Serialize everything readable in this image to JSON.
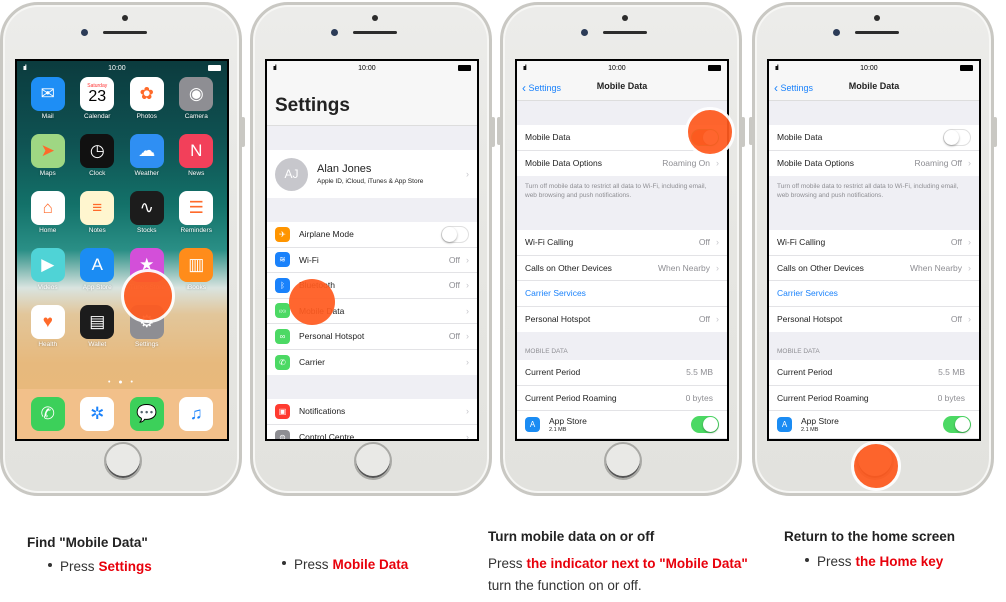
{
  "status_bar": {
    "time": "10:00",
    "signal": "ııl"
  },
  "phone1": {
    "apps": [
      {
        "label": "Mail",
        "icon": "mail-icon",
        "glyph": "✉",
        "color": "#1e8ef5"
      },
      {
        "label": "Calendar",
        "icon": "calendar-icon",
        "day": "Saturday",
        "date": "23",
        "color": "#ffffff"
      },
      {
        "label": "Photos",
        "icon": "photos-icon",
        "glyph": "✿",
        "color": "#ffffff"
      },
      {
        "label": "Camera",
        "icon": "camera-icon",
        "glyph": "◉",
        "color": "#8e8e93"
      },
      {
        "label": "Maps",
        "icon": "maps-icon",
        "glyph": "➤",
        "color": "#9fd783"
      },
      {
        "label": "Clock",
        "icon": "clock-icon",
        "glyph": "◷",
        "color": "#111111"
      },
      {
        "label": "Weather",
        "icon": "weather-icon",
        "glyph": "☁",
        "color": "#2f8ff3"
      },
      {
        "label": "News",
        "icon": "news-icon",
        "glyph": "N",
        "color": "#f2405a"
      },
      {
        "label": "Home",
        "icon": "home-app-icon",
        "glyph": "⌂",
        "color": "#ffffff"
      },
      {
        "label": "Notes",
        "icon": "notes-icon",
        "glyph": "≡",
        "color": "#fff6cf"
      },
      {
        "label": "Stocks",
        "icon": "stocks-icon",
        "glyph": "∿",
        "color": "#1c1c1c"
      },
      {
        "label": "Reminders",
        "icon": "reminders-icon",
        "glyph": "☰",
        "color": "#ffffff"
      },
      {
        "label": "Videos",
        "icon": "videos-icon",
        "glyph": "▶",
        "color": "#4fd3d6"
      },
      {
        "label": "App Store",
        "icon": "app-store-icon",
        "glyph": "A",
        "color": "#1b8cf3"
      },
      {
        "label": "iTunes Store",
        "icon": "itunes-store-icon",
        "glyph": "★",
        "color": "#d34fd9"
      },
      {
        "label": "iBooks",
        "icon": "ibooks-icon",
        "glyph": "▥",
        "color": "#ff8c1a"
      },
      {
        "label": "Health",
        "icon": "health-icon",
        "glyph": "♥",
        "color": "#ffffff"
      },
      {
        "label": "Wallet",
        "icon": "wallet-icon",
        "glyph": "▤",
        "color": "#1c1c1c"
      },
      {
        "label": "Settings",
        "icon": "settings-icon",
        "glyph": "⚙",
        "color": "#8e8e93"
      }
    ],
    "pager": "• ● •",
    "dock": [
      {
        "icon": "phone-icon",
        "glyph": "✆",
        "color": "#3cd05a"
      },
      {
        "icon": "safari-icon",
        "glyph": "✲",
        "color": "#ffffff"
      },
      {
        "icon": "messages-icon",
        "glyph": "💬",
        "color": "#3cd05a"
      },
      {
        "icon": "music-icon",
        "glyph": "♫",
        "color": "#ffffff"
      }
    ]
  },
  "phone2": {
    "title": "Settings",
    "profile": {
      "initials": "AJ",
      "name": "Alan Jones",
      "subtitle": "Apple ID, iCloud, iTunes & App Store"
    },
    "rows1": [
      {
        "label": "Airplane Mode",
        "value": "",
        "icon": "airplane-icon",
        "glyph": "✈",
        "color": "#ff9500",
        "toggle": "off"
      },
      {
        "label": "Wi-Fi",
        "value": "Off",
        "icon": "wifi-icon",
        "glyph": "≋",
        "color": "#1a82fb"
      },
      {
        "label": "Bluetooth",
        "value": "Off",
        "icon": "bluetooth-icon",
        "glyph": "ᛒ",
        "color": "#1a82fb"
      },
      {
        "label": "Mobile Data",
        "value": "",
        "icon": "mobile-data-icon",
        "glyph": "((•))",
        "color": "#4cd964"
      },
      {
        "label": "Personal Hotspot",
        "value": "Off",
        "icon": "hotspot-icon",
        "glyph": "∞",
        "color": "#4cd964"
      },
      {
        "label": "Carrier",
        "value": "",
        "icon": "carrier-icon",
        "glyph": "✆",
        "color": "#4cd964"
      }
    ],
    "rows2": [
      {
        "label": "Notifications",
        "icon": "notifications-icon",
        "glyph": "▣",
        "color": "#ff3b30"
      },
      {
        "label": "Control Centre",
        "icon": "control-centre-icon",
        "glyph": "⊜",
        "color": "#8e8e93"
      }
    ]
  },
  "mobile_data_screen": {
    "back_label": "Settings",
    "title": "Mobile Data",
    "row_mobile_data": "Mobile Data",
    "row_options": "Mobile Data Options",
    "footnote": "Turn off mobile data to restrict all data to Wi-Fi, including email, web browsing and push notifications.",
    "rows2": [
      {
        "label": "Wi-Fi Calling",
        "value": "Off"
      },
      {
        "label": "Calls on Other Devices",
        "value": "When Nearby"
      },
      {
        "label": "Carrier Services",
        "value": "",
        "link": true
      },
      {
        "label": "Personal Hotspot",
        "value": "Off"
      }
    ],
    "section_header": "MOBILE DATA",
    "usage_rows": [
      {
        "label": "Current Period",
        "value": "5.5 MB"
      },
      {
        "label": "Current Period Roaming",
        "value": "0 bytes"
      }
    ],
    "app_usage": {
      "name": "App Store",
      "size": "2.1 MB",
      "enabled": true
    }
  },
  "phone3": {
    "roaming_value": "Roaming On",
    "mobile_data_on": true
  },
  "phone4": {
    "roaming_value": "Roaming Off",
    "mobile_data_on": false
  },
  "captions": {
    "step1": {
      "title": "Find \"Mobile Data\"",
      "prefix": "Press",
      "highlight": "Settings"
    },
    "step2": {
      "prefix": "Press",
      "highlight": "Mobile Data"
    },
    "step3": {
      "title": "Turn mobile data on or off",
      "prefix": "Press",
      "highlight": "the indicator next to \"Mobile Data\"",
      "line2": "turn the function on or off."
    },
    "step4": {
      "title": "Return to the home screen",
      "prefix": "Press",
      "highlight": "the Home key"
    }
  },
  "colors": {
    "tap_indicator": "#ff5a1f",
    "highlight_text": "#e8000b",
    "ios_blue": "#1a82fb",
    "ios_green": "#4cd964"
  }
}
